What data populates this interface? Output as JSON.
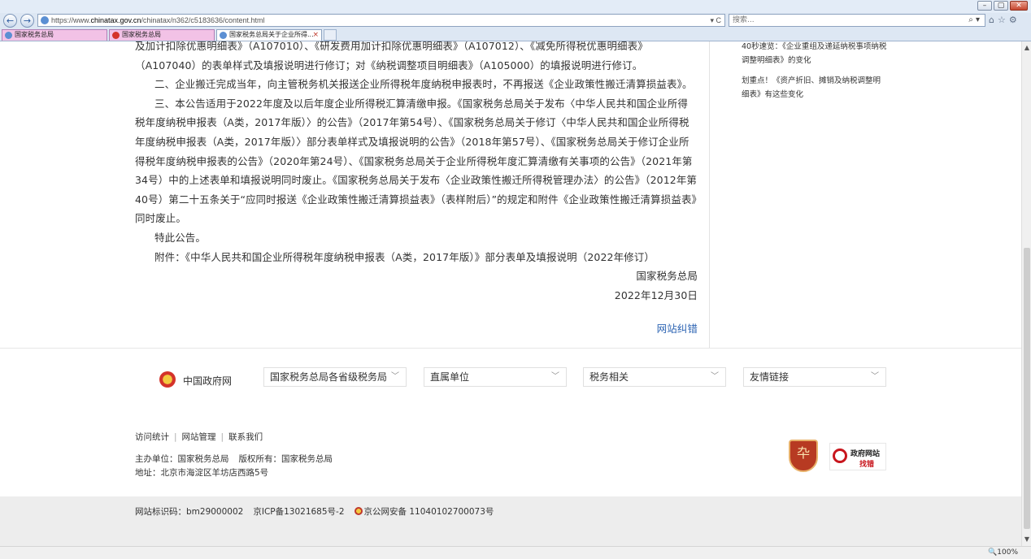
{
  "browser": {
    "url_prefix": "https://www.",
    "url_domain": "chinatax.gov.cn",
    "url_path": "/chinatax/n362/c5183636/content.html",
    "url_tools": "▾ C",
    "search_placeholder": "搜索...",
    "search_tools": "⌕ ▾",
    "tabs": [
      {
        "label": "国家税务总局"
      },
      {
        "label": "国家税务总局"
      },
      {
        "label": "国家税务总局关于企业所得..."
      }
    ],
    "tab_close": "×",
    "zoom": "🔍100%"
  },
  "article": {
    "paragraphs": [
      "及加计扣除优惠明细表》（A107010）、《研发费用加计扣除优惠明细表》（A107012）、《减免所得税优惠明细表》（A107040）的表单样式及填报说明进行修订；对《纳税调整项目明细表》（A105000）的填报说明进行修订。",
      "二、企业搬迁完成当年，向主管税务机关报送企业所得税年度纳税申报表时，不再报送《企业政策性搬迁清算损益表》。",
      "三、本公告适用于2022年度及以后年度企业所得税汇算清缴申报。《国家税务总局关于发布〈中华人民共和国企业所得税年度纳税申报表（A类，2017年版）〉的公告》（2017年第54号）、《国家税务总局关于修订〈中华人民共和国企业所得税年度纳税申报表（A类，2017年版）〉部分表单样式及填报说明的公告》（2018年第57号）、《国家税务总局关于修订企业所得税年度纳税申报表的公告》（2020年第24号）、《国家税务总局关于企业所得税年度汇算清缴有关事项的公告》（2021年第34号）中的上述表单和填报说明同时废止。《国家税务总局关于发布〈企业政策性搬迁所得税管理办法〉的公告》（2012年第40号）第二十五条关于“应同时报送《企业政策性搬迁清算损益表》（表样附后）”的规定和附件《企业政策性搬迁清算损益表》同时废止。",
      "特此公告。",
      "附件：《中华人民共和国企业所得税年度纳税申报表（A类，2017年版）》部分表单及填报说明（2022年修订）"
    ],
    "signature": "国家税务总局",
    "date": "2022年12月30日",
    "error_link": "网站纠错"
  },
  "sidebar": {
    "items": [
      "40秒速览：《企业重组及递延纳税事项纳税调整明细表》的变化",
      "划重点！《资产折旧、摊销及纳税调整明细表》有这些变化"
    ]
  },
  "footer": {
    "gov_site": "中国政府网",
    "selects": [
      {
        "label": "国家税务总局各省级税务局"
      },
      {
        "label": "直属单位"
      },
      {
        "label": "税务相关"
      },
      {
        "label": "友情链接"
      }
    ],
    "links": [
      "访问统计",
      "网站管理",
      "联系我们"
    ],
    "sponsor": "主办单位：国家税务总局",
    "copyright": "版权所有：国家税务总局",
    "address": "地址：北京市海淀区羊坊店西路5号",
    "badge_find_title": "政府网站",
    "badge_find_sub": "找错",
    "site_id": "网站标识码：bm29000002",
    "icp": "京ICP备13021685号-2",
    "police": "京公网安备 11040102700073号"
  }
}
